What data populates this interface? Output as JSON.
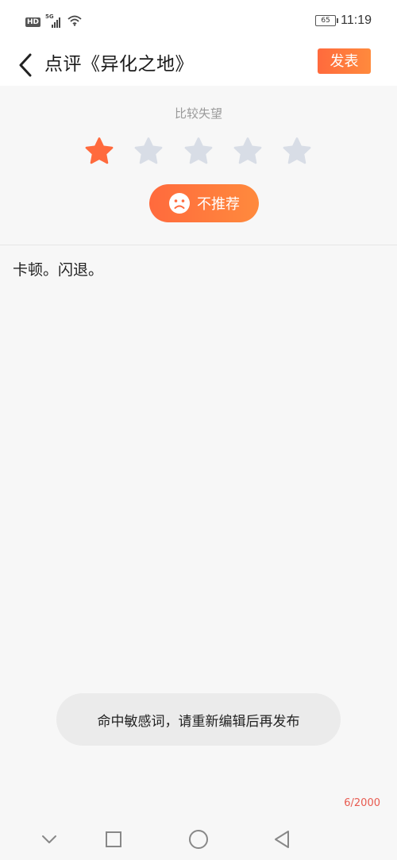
{
  "status_bar": {
    "hd_label": "HD",
    "network_label": "5G",
    "battery_level": "65",
    "time": "11:19"
  },
  "header": {
    "back_icon": "chevron-left-icon",
    "title": "点评《异化之地》",
    "publish_label": "发表"
  },
  "rating": {
    "label": "比较失望",
    "value": 1,
    "max": 5,
    "active_color": "#ff6a3d",
    "inactive_color": "#d8dde6",
    "recommend_icon": "sad-face-icon",
    "recommend_label": "不推荐"
  },
  "review": {
    "text": "卡顿。闪退。",
    "char_count": "6/2000"
  },
  "toast": {
    "message": "命中敏感词，请重新编辑后再发布"
  },
  "system_nav": {
    "icons": [
      "chevron-down-icon",
      "square-icon",
      "circle-icon",
      "triangle-back-icon"
    ]
  },
  "colors": {
    "accent": "#ff6a3d",
    "count_text": "#e85a4f",
    "background": "#f7f7f7"
  }
}
